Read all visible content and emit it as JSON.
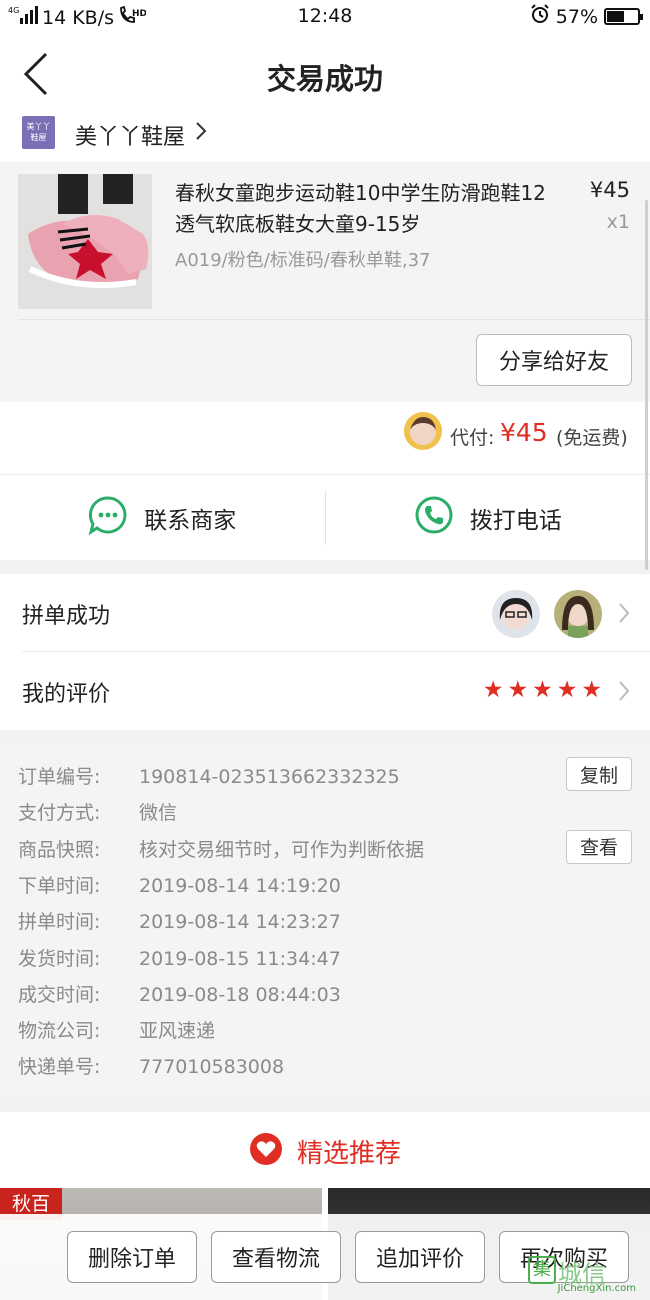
{
  "status_bar": {
    "network": "4G",
    "speed": "14 KB/s",
    "hd": "HD",
    "time": "12:48",
    "battery": "57%",
    "battery_level": 0.57
  },
  "header": {
    "title": "交易成功"
  },
  "shop": {
    "logo_text_line1": "美丫丫",
    "logo_text_line2": "鞋屋",
    "name": "美丫丫鞋屋"
  },
  "product": {
    "title": "春秋女童跑步运动鞋10中学生防滑跑鞋12透气软底板鞋女大童9-15岁",
    "price": "¥45",
    "qty": "x1",
    "spec": "A019/粉色/标准码/春秋单鞋,37",
    "share_label": "分享给好友"
  },
  "payment": {
    "label": "代付:",
    "amount": "¥45",
    "note": "(免运费)"
  },
  "contact": {
    "merchant_label": "联系商家",
    "call_label": "拨打电话"
  },
  "group_row": {
    "label": "拼单成功"
  },
  "review_row": {
    "label": "我的评价",
    "stars": 5
  },
  "order_info": [
    {
      "key": "订单编号:",
      "value": "190814-023513662332325",
      "button": "复制"
    },
    {
      "key": "支付方式:",
      "value": "微信"
    },
    {
      "key": "商品快照:",
      "value": "核对交易细节时，可作为判断依据",
      "button": "查看"
    },
    {
      "key": "下单时间:",
      "value": "2019-08-14 14:19:20"
    },
    {
      "key": "拼单时间:",
      "value": "2019-08-14 14:23:27"
    },
    {
      "key": "发货时间:",
      "value": "2019-08-15 11:34:47"
    },
    {
      "key": "成交时间:",
      "value": "2019-08-18 08:44:03"
    },
    {
      "key": "物流公司:",
      "value": "亚风速递"
    },
    {
      "key": "快递单号:",
      "value": "777010583008"
    }
  ],
  "recommend": {
    "title": "精选推荐",
    "badge": "秋百"
  },
  "bottom_bar": {
    "buttons": [
      "删除订单",
      "查看物流",
      "追加评价",
      "再次购买"
    ]
  },
  "watermark": {
    "text": "JiChengXin.com",
    "big": "城信",
    "box": "集"
  },
  "colors": {
    "accent": "#e02e24",
    "green": "#2aae67",
    "bg_gray": "#f4f4f4"
  }
}
